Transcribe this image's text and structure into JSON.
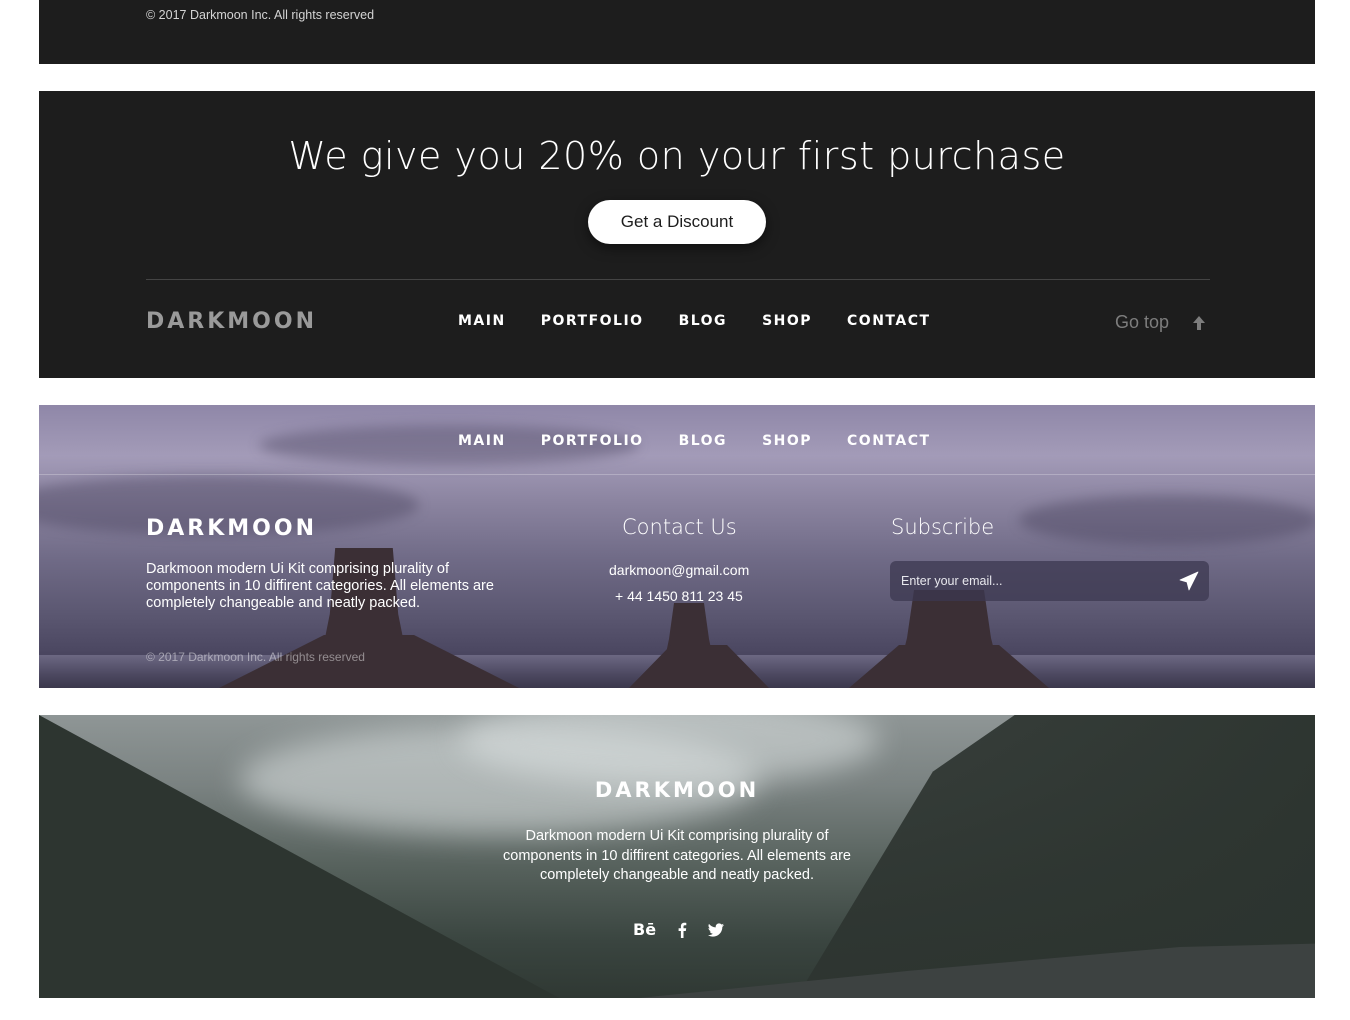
{
  "footer1": {
    "copyright": "© 2017 Darkmoon Inc. All rights reserved"
  },
  "footer2": {
    "promo_title": "We give you 20% on your first purchase",
    "discount_button": "Get a Discount",
    "brand": "DARKMOON",
    "nav": [
      "MAIN",
      "PORTFOLIO",
      "BLOG",
      "SHOP",
      "CONTACT"
    ],
    "go_top": "Go top",
    "go_top_icon": "arrow-up-icon"
  },
  "footer3": {
    "nav": [
      "MAIN",
      "PORTFOLIO",
      "BLOG",
      "SHOP",
      "CONTACT"
    ],
    "brand": "DARKMOON",
    "about": "Darkmoon modern Ui Kit comprising plurality of components in 10 diffirent categories. All elements are completely changeable and neatly packed.",
    "copyright": "© 2017 Darkmoon Inc. All rights reserved",
    "contact_heading": "Contact Us",
    "contact_email": "darkmoon@gmail.com",
    "contact_phone": "+ 44 1450 811 23 45",
    "subscribe_heading": "Subscribe",
    "subscribe_placeholder": "Enter your email...",
    "send_icon": "paper-plane-icon"
  },
  "footer4": {
    "brand": "DARKMOON",
    "about": "Darkmoon modern Ui Kit comprising plurality of components in 10 diffirent categories. All elements are completely changeable and neatly packed.",
    "socials": {
      "behance": "Bē",
      "facebook_icon": "facebook-icon",
      "twitter_icon": "twitter-icon"
    }
  },
  "colors": {
    "dark_bg": "#1d1d1d",
    "text_light": "#ffffff",
    "muted": "#9a9a9a"
  }
}
